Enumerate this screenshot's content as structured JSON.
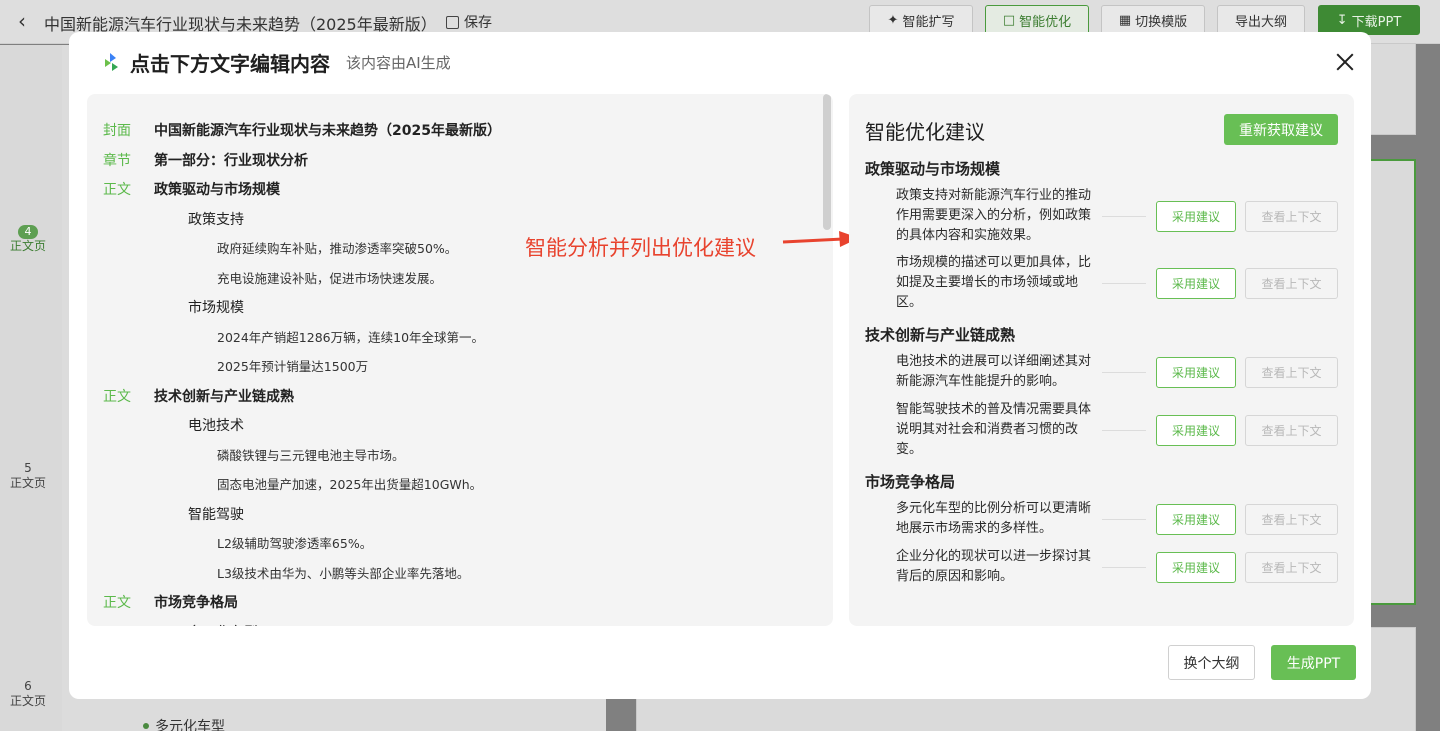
{
  "app": {
    "title": "中国新能源汽车行业现状与未来趋势（2025年最新版）",
    "save_label": "保存",
    "toolbar": [
      {
        "label": "智能扩写",
        "icon": "sparkle-icon"
      },
      {
        "label": "智能优化",
        "icon": "optimize-icon"
      },
      {
        "label": "切换模版",
        "icon": "template-icon"
      },
      {
        "label": "导出大纲",
        "icon": ""
      },
      {
        "label": "下载PPT",
        "icon": "download-icon"
      }
    ],
    "sidebar_pages": [
      {
        "num": "4",
        "label": "正文页"
      },
      {
        "num": "5",
        "label": "正文页"
      },
      {
        "num": "6",
        "label": "正文页"
      }
    ],
    "bg_bullet": "多元化车型"
  },
  "modal": {
    "title": "点击下方文字编辑内容",
    "subtitle": "该内容由AI生成",
    "outline": [
      {
        "tag": "封面",
        "level": 1,
        "text": "中国新能源汽车行业现状与未来趋势（2025年最新版）"
      },
      {
        "tag": "章节",
        "level": 1,
        "text": "第一部分：行业现状分析"
      },
      {
        "tag": "正文",
        "level": 1,
        "text": "政策驱动与市场规模"
      },
      {
        "tag": "",
        "level": 2,
        "text": "政策支持"
      },
      {
        "tag": "",
        "level": 3,
        "text": "政府延续购车补贴，推动渗透率突破50%。"
      },
      {
        "tag": "",
        "level": 3,
        "text": "充电设施建设补贴，促进市场快速发展。"
      },
      {
        "tag": "",
        "level": 2,
        "text": "市场规模"
      },
      {
        "tag": "",
        "level": 3,
        "text": "2024年产销超1286万辆，连续10年全球第一。"
      },
      {
        "tag": "",
        "level": 3,
        "text": "2025年预计销量达1500万"
      },
      {
        "tag": "正文",
        "level": 1,
        "text": "技术创新与产业链成熟"
      },
      {
        "tag": "",
        "level": 2,
        "text": "电池技术"
      },
      {
        "tag": "",
        "level": 3,
        "text": "磷酸铁锂与三元锂电池主导市场。"
      },
      {
        "tag": "",
        "level": 3,
        "text": "固态电池量产加速，2025年出货量超10GWh。"
      },
      {
        "tag": "",
        "level": 2,
        "text": "智能驾驶"
      },
      {
        "tag": "",
        "level": 3,
        "text": "L2级辅助驾驶渗透率65%。"
      },
      {
        "tag": "",
        "level": 3,
        "text": "L3级技术由华为、小鹏等头部企业率先落地。"
      },
      {
        "tag": "正文",
        "level": 1,
        "text": "市场竞争格局"
      },
      {
        "tag": "",
        "level": 2,
        "text": "多元化车型"
      }
    ],
    "annotation": "智能分析并列出优化建议",
    "suggestions_title": "智能优化建议",
    "refresh_label": "重新获取建议",
    "adopt_label": "采用建议",
    "context_label": "查看上下文",
    "sections": [
      {
        "title": "政策驱动与市场规模",
        "items": [
          "政策支持对新能源汽车行业的推动作用需要更深入的分析，例如政策的具体内容和实施效果。",
          "市场规模的描述可以更加具体，比如提及主要增长的市场领域或地区。"
        ]
      },
      {
        "title": "技术创新与产业链成熟",
        "items": [
          "电池技术的进展可以详细阐述其对新能源汽车性能提升的影响。",
          "智能驾驶技术的普及情况需要具体说明其对社会和消费者习惯的改变。"
        ]
      },
      {
        "title": "市场竞争格局",
        "items": [
          "多元化车型的比例分析可以更清晰地展示市场需求的多样性。",
          "企业分化的现状可以进一步探讨其背后的原因和影响。"
        ]
      }
    ],
    "switch_outline_label": "换个大纲",
    "generate_label": "生成PPT"
  }
}
